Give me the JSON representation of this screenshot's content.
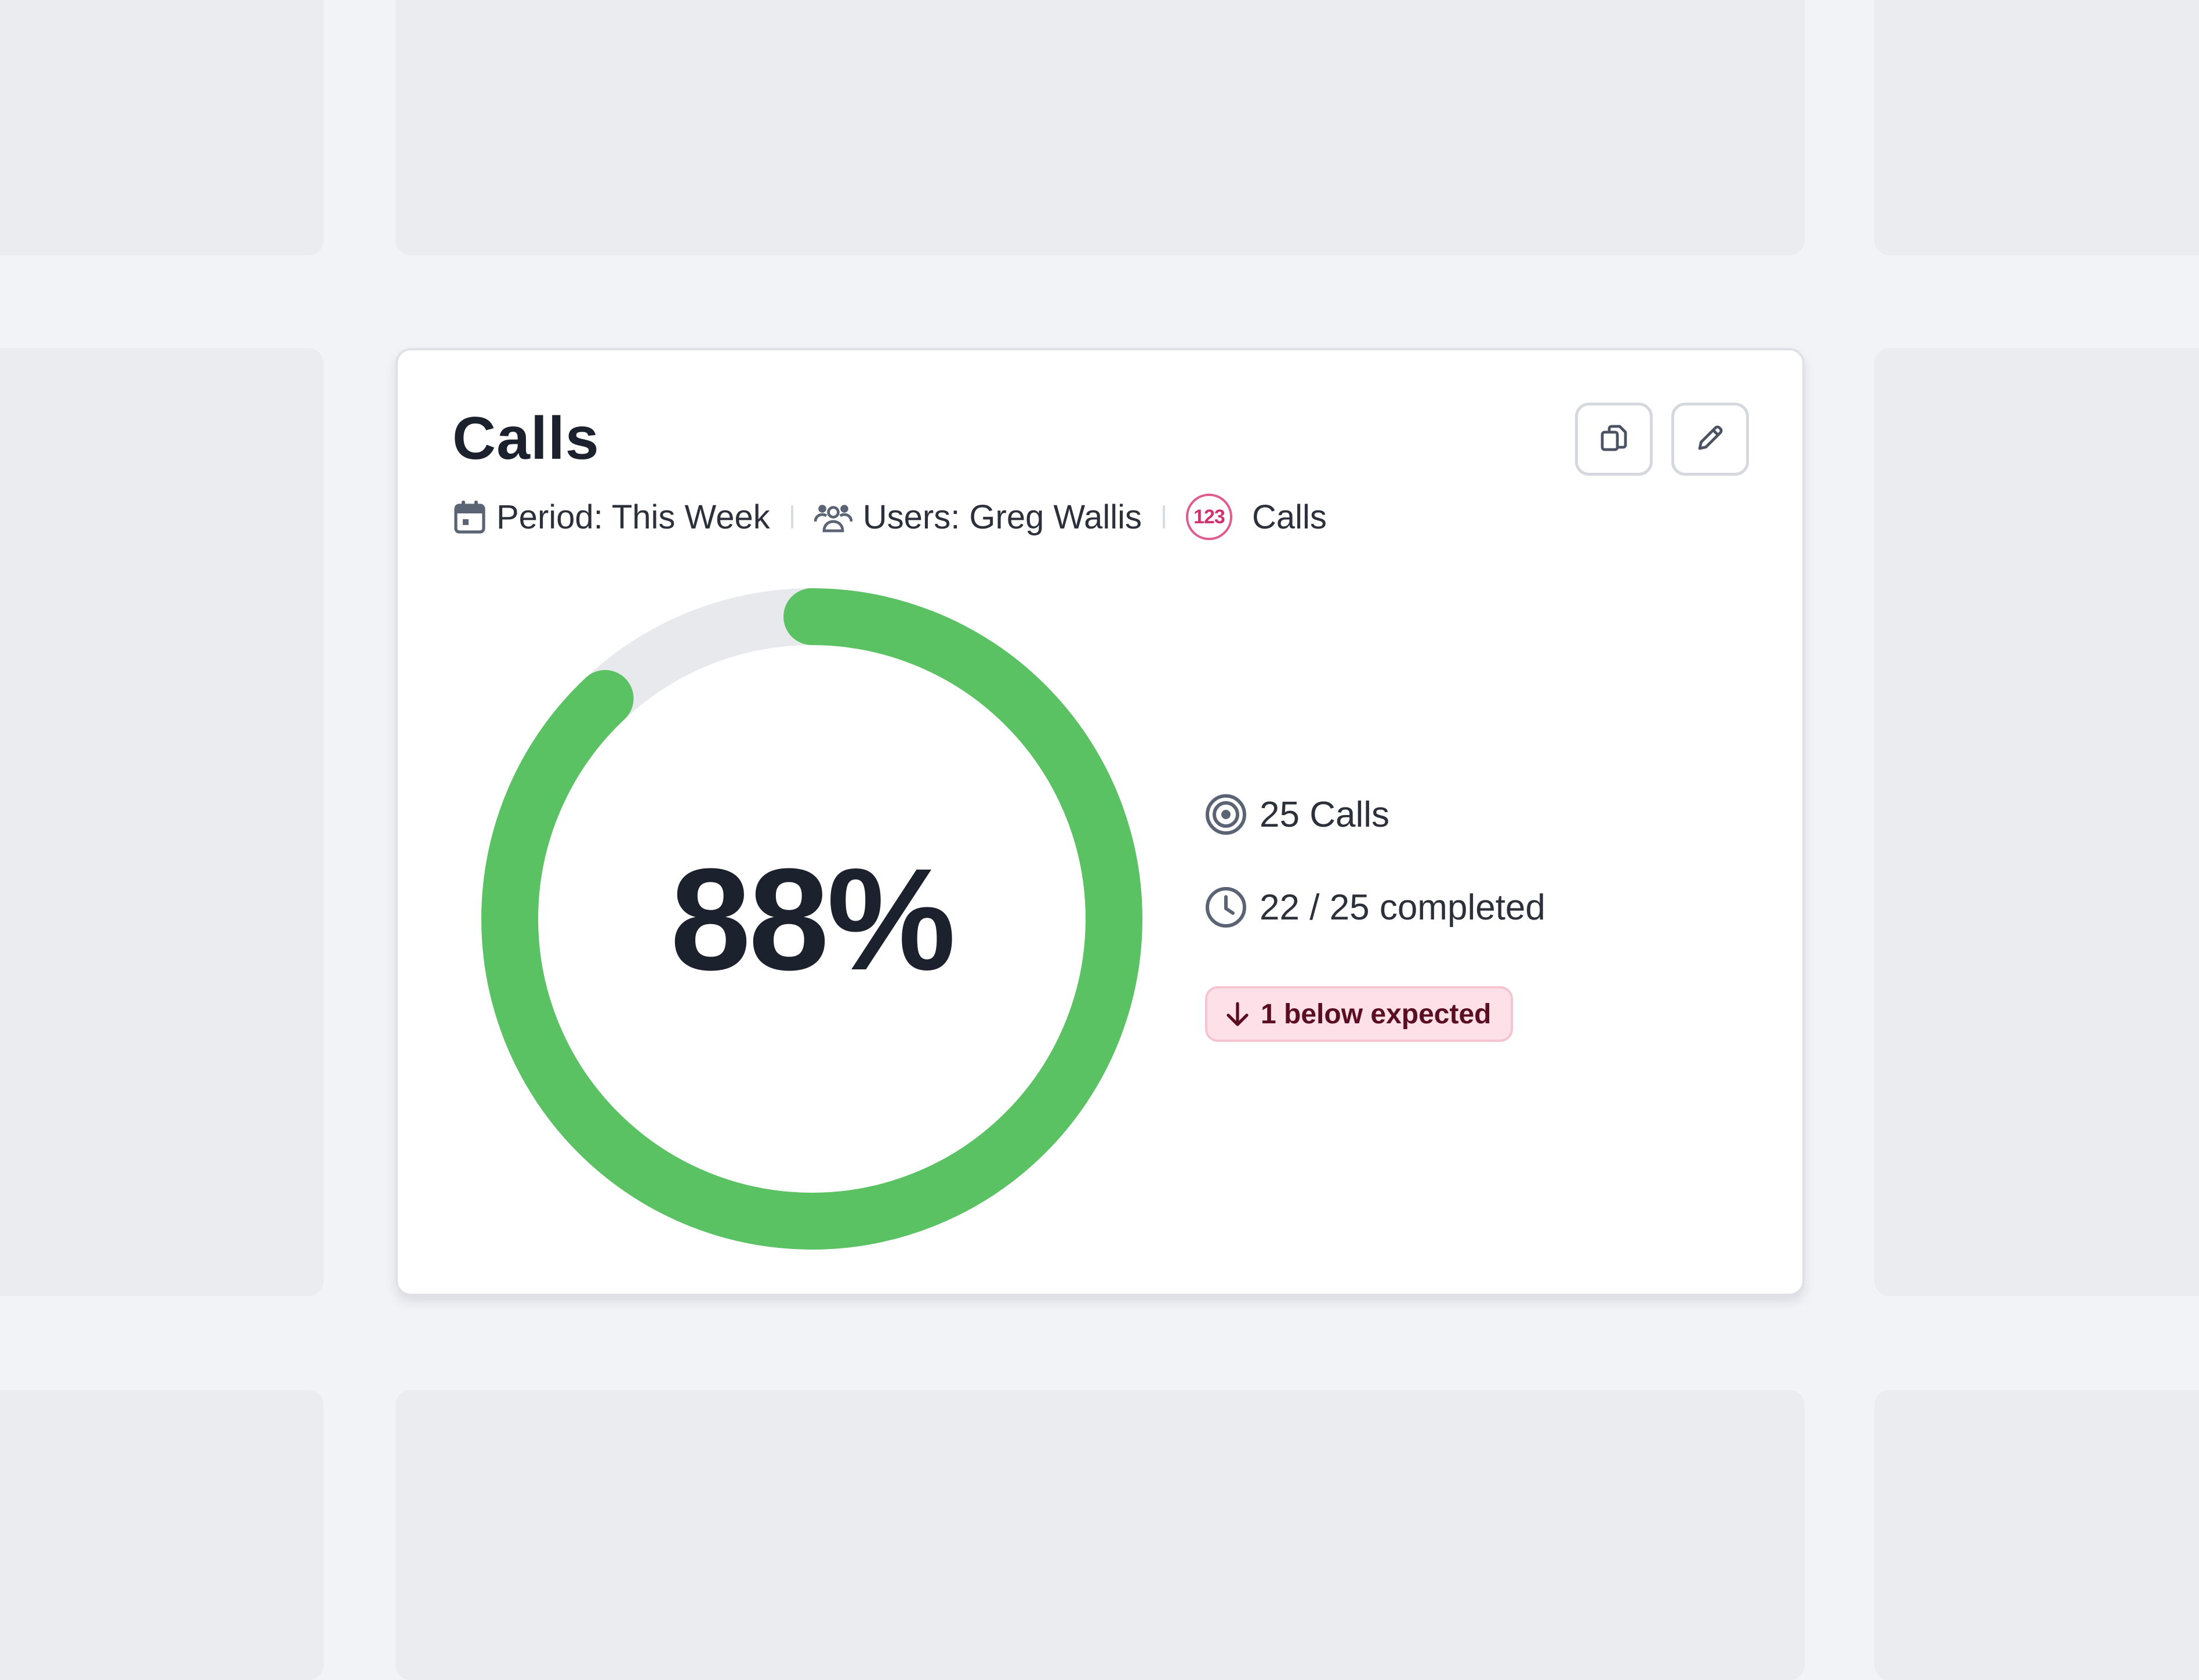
{
  "widget": {
    "title": "Calls",
    "meta": {
      "period": "Period: This Week",
      "users": "Users: Greg Wallis",
      "metric_badge": "123",
      "metric": "Calls"
    },
    "actions": {
      "copy_icon": "copy-icon",
      "edit_icon": "pencil-icon"
    },
    "progress": {
      "percent_label": "88%",
      "fraction": 0.88,
      "fill_color": "#5ac262",
      "track_color": "#e8e9ec"
    },
    "stats": {
      "target": "25 Calls",
      "completed": "22 / 25 completed",
      "status": "1 below expected",
      "status_color": "#fde0e8"
    }
  }
}
